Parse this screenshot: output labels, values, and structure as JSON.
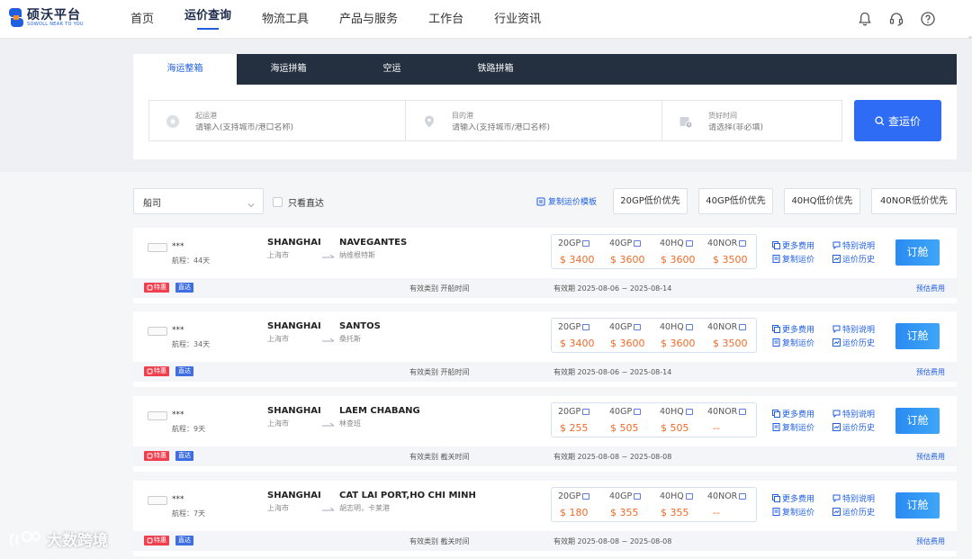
{
  "brand": {
    "name": "硕沃平台",
    "tagline": "SOWOLL NEAR TO YOU"
  },
  "nav": [
    {
      "label": "首页"
    },
    {
      "label": "运价查询"
    },
    {
      "label": "物流工具"
    },
    {
      "label": "产品与服务"
    },
    {
      "label": "工作台"
    },
    {
      "label": "行业资讯"
    }
  ],
  "tabs": [
    {
      "label": "海运整箱"
    },
    {
      "label": "海运拼箱"
    },
    {
      "label": "空运"
    },
    {
      "label": "铁路拼箱"
    }
  ],
  "search": {
    "origin": {
      "label": "起运港",
      "placeholder": "请输入(支持城市/港口名称)"
    },
    "destination": {
      "label": "目的港",
      "placeholder": "请输入(支持城市/港口名称)"
    },
    "cargo_time": {
      "label": "货好时间",
      "placeholder": "请选择(非必填)"
    },
    "button": "查运价"
  },
  "filters": {
    "carrier": "船司",
    "direct_only": "只看直达",
    "copy_template": "复制运价模板",
    "sort_options": [
      "20GP低价优先",
      "40GP低价优先",
      "40HQ低价优先",
      "40NOR低价优先"
    ]
  },
  "card_labels": {
    "more_fees": "更多费用",
    "special_note": "特别说明",
    "copy_rate": "复制运价",
    "rate_history": "运价历史",
    "book": "订舱",
    "badge_special": "特惠",
    "badge_direct": "直达",
    "validity_type_prefix": "有效类别",
    "estimate": "预估费用",
    "containers": [
      "20GP",
      "40GP",
      "40HQ",
      "40NOR"
    ]
  },
  "results": [
    {
      "carrier": "***",
      "transit": "航程：44天",
      "pol_en": "SHANGHAI",
      "pol_cn": "上海市",
      "pod_en": "NAVEGANTES",
      "pod_cn": "纳维根特斯",
      "prices": [
        "$ 3400",
        "$ 3600",
        "$ 3600",
        "$ 3500"
      ],
      "validity_type": "开船时间",
      "validity": "有效期 2025-08-06 ~ 2025-08-14"
    },
    {
      "carrier": "***",
      "transit": "航程：34天",
      "pol_en": "SHANGHAI",
      "pol_cn": "上海市",
      "pod_en": "SANTOS",
      "pod_cn": "桑托斯",
      "prices": [
        "$ 3400",
        "$ 3600",
        "$ 3600",
        "$ 3500"
      ],
      "validity_type": "开船时间",
      "validity": "有效期 2025-08-06 ~ 2025-08-14"
    },
    {
      "carrier": "***",
      "transit": "航程：9天",
      "pol_en": "SHANGHAI",
      "pol_cn": "上海市",
      "pod_en": "LAEM CHABANG",
      "pod_cn": "林查班",
      "prices": [
        "$ 255",
        "$ 505",
        "$ 505",
        "--"
      ],
      "validity_type": "截关时间",
      "validity": "有效期 2025-08-08 ~ 2025-08-08"
    },
    {
      "carrier": "***",
      "transit": "航程：7天",
      "pol_en": "SHANGHAI",
      "pol_cn": "上海市",
      "pod_en": "CAT LAI PORT,HO CHI MINH",
      "pod_cn": "胡志明，卡莱港",
      "prices": [
        "$ 180",
        "$ 355",
        "$ 355",
        "--"
      ],
      "validity_type": "截关时间",
      "validity": "有效期 2025-08-08 ~ 2025-08-08"
    }
  ],
  "watermark": "大数跨境",
  "colors": {
    "primary": "#1f5fe0",
    "price": "#f06a2a",
    "tab_bar": "#24303f",
    "badge_red": "#f0404f"
  }
}
